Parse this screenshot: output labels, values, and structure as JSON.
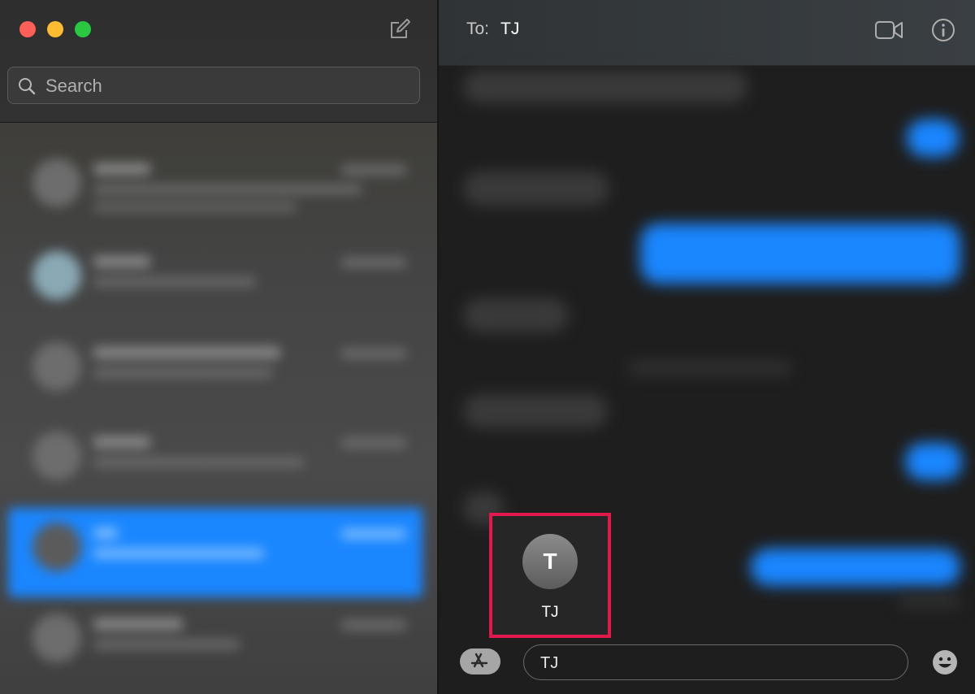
{
  "sidebar": {
    "search": {
      "placeholder": "Search"
    }
  },
  "header": {
    "to_label": "To:",
    "recipient": "TJ"
  },
  "contact_card": {
    "initial": "T",
    "name": "TJ"
  },
  "compose": {
    "text": "TJ"
  },
  "colors": {
    "accent": "#1a86ff",
    "highlight_border": "#e3194b"
  }
}
